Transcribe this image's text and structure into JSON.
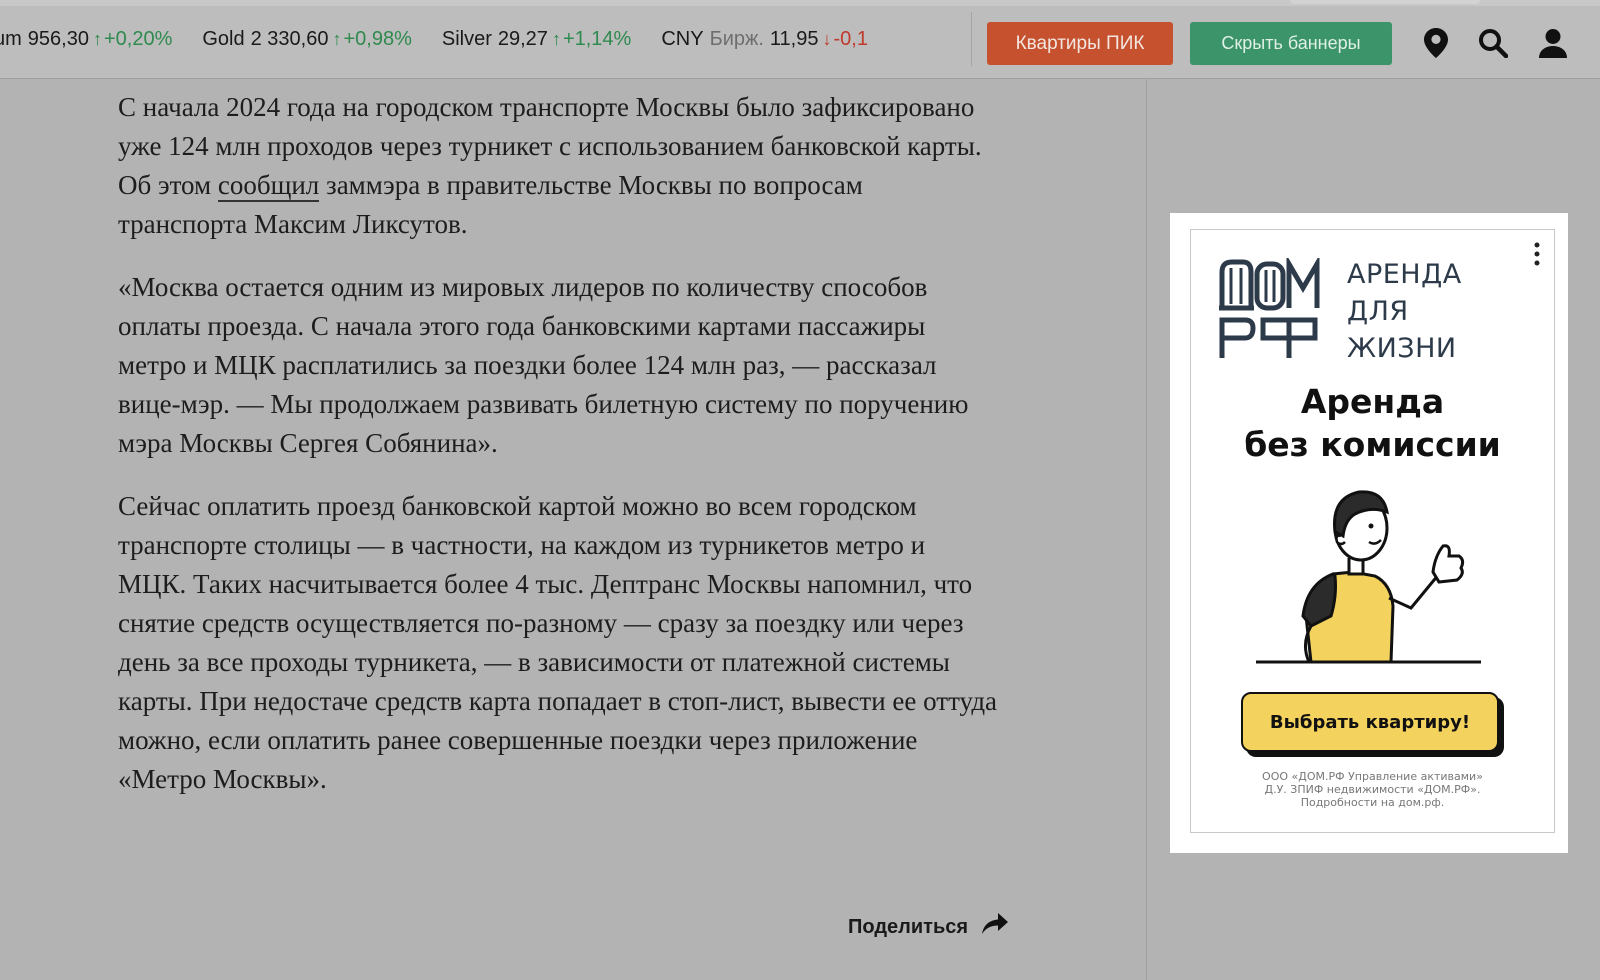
{
  "ticker": [
    {
      "symbol": "um",
      "sub": "",
      "value": "956,30",
      "direction": "up",
      "change": "+0,20%"
    },
    {
      "symbol": "Gold",
      "sub": "",
      "value": "2 330,60",
      "direction": "up",
      "change": "+0,98%"
    },
    {
      "symbol": "Silver",
      "sub": "",
      "value": "29,27",
      "direction": "up",
      "change": "+1,14%"
    },
    {
      "symbol": "CNY",
      "sub": "Бирж.",
      "value": "11,95",
      "direction": "down",
      "change": "-0,1"
    }
  ],
  "header": {
    "pik_button": "Квартиры ПИК",
    "hide_banners_button": "Скрыть баннеры",
    "icons": [
      "location-pin-icon",
      "search-icon",
      "user-icon"
    ]
  },
  "article": {
    "p1_before": "С начала 2024 года на городском транспорте Москвы было зафиксировано уже 124 млн проходов через турникет с использованием банковской карты. Об этом ",
    "p1_link": "сообщил",
    "p1_after": " заммэра в правительстве Москвы по вопросам транспорта Максим Ликсутов.",
    "p2": "«Москва остается одним из мировых лидеров по количеству способов оплаты проезда. С начала этого года банковскими картами пассажиры метро и МЦК расплатились за поездки более 124 млн раз, — рассказал вице-мэр. — Мы продолжаем развивать билетную систему по поручению мэра Москвы Сергея Собянина».",
    "p3": "Сейчас оплатить проезд банковской картой можно во всем городском транспорте столицы — в частности, на каждом из турникетов метро и МЦК. Таких насчитывается более 4 тыс. Дептранс Москвы напомнил, что снятие средств осуществляется по-разному — сразу за поездку или через день за все проходы турникета, — в зависимости от платежной системы карты. При недостаче средств карта попадает в стоп-лист, вывести ее оттуда можно, если оплатить ранее совершенные поездки через приложение «Метро Москвы».",
    "share_label": "Поделиться"
  },
  "ad": {
    "logo_top": "ДОМ",
    "logo_bottom": "РФ",
    "tagline": [
      "АРЕНДА",
      "ДЛЯ",
      "ЖИЗНИ"
    ],
    "headline_line1": "Аренда",
    "headline_line2": "без комиссии",
    "cta": "Выбрать квартиру!",
    "legal": [
      "ООО «ДОМ.РФ Управление активами»",
      "Д.У. ЗПИФ недвижимости «ДОМ.РФ».",
      "Подробности на дом.рф."
    ]
  },
  "colors": {
    "pik_button": "#c5512f",
    "hide_button": "#3b946a",
    "ticker_up": "#2f8a4e",
    "ticker_down": "#c0392b",
    "ad_cta": "#f3d35d",
    "logo": "#2c3a4a"
  }
}
